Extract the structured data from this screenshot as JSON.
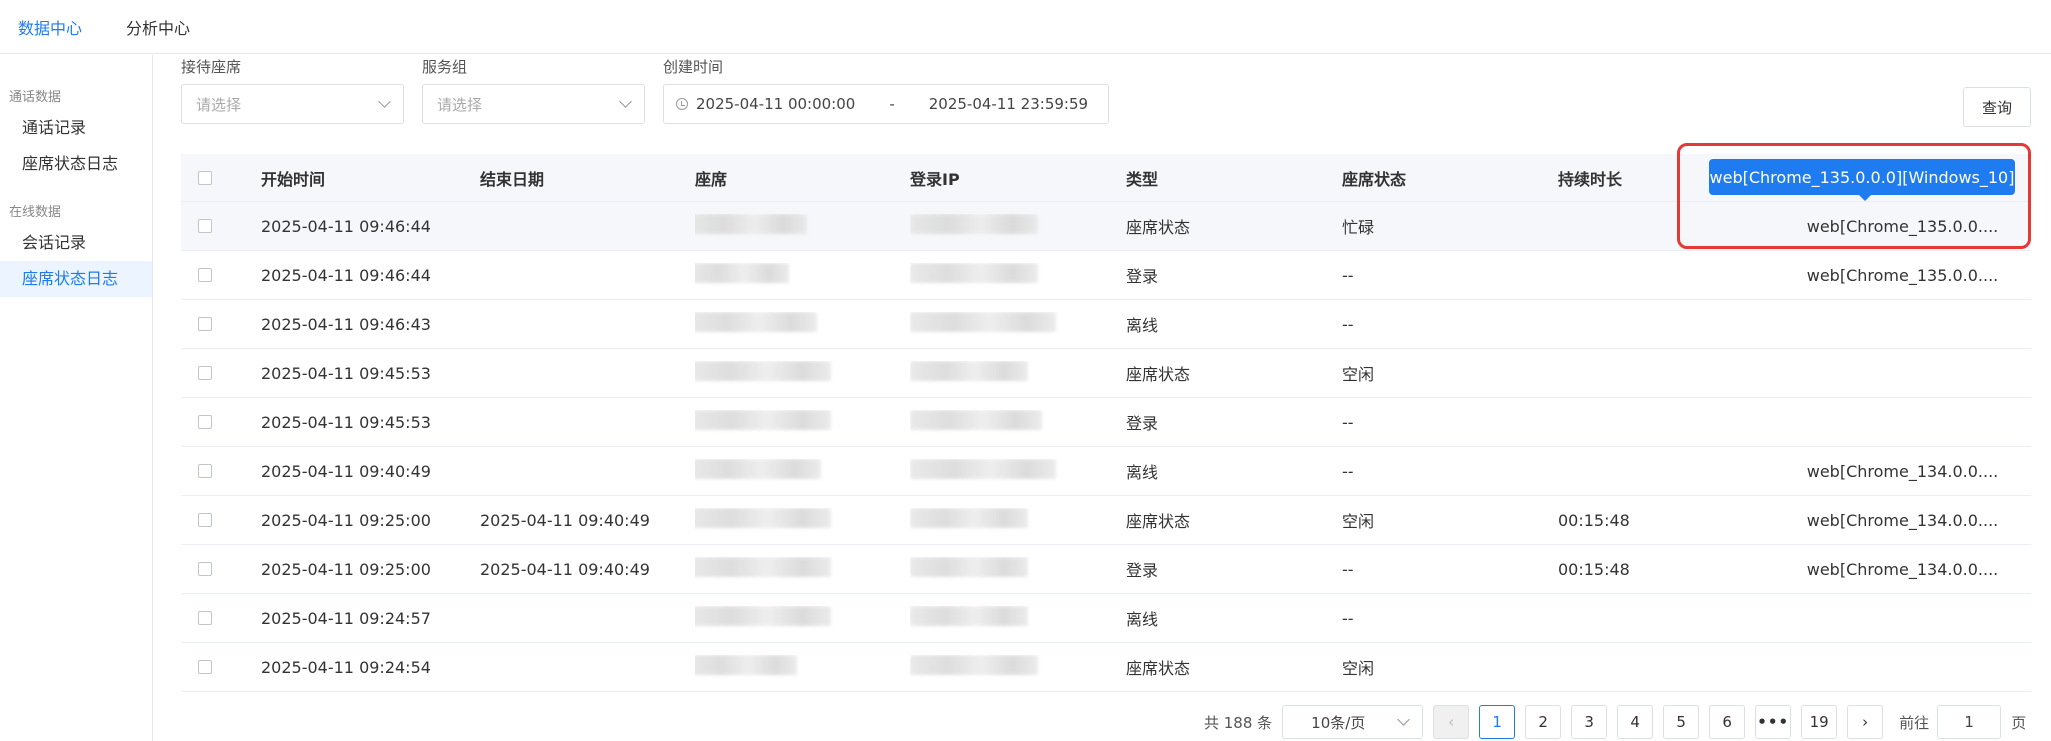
{
  "topnav": {
    "items": [
      {
        "label": "数据中心",
        "active": true
      },
      {
        "label": "分析中心",
        "active": false
      }
    ]
  },
  "sidebar": {
    "group1": "通话数据",
    "call_records": "通话记录",
    "seat_log_1": "座席状态日志",
    "group2": "在线数据",
    "session_records": "会话记录",
    "seat_log_2": "座席状态日志"
  },
  "filters": {
    "agent_label": "接待座席",
    "agent_placeholder": "请选择",
    "group_label": "服务组",
    "group_placeholder": "请选择",
    "created_label": "创建时间",
    "date_start": "2025-04-11 00:00:00",
    "date_sep": "-",
    "date_end": "2025-04-11 23:59:59",
    "query_button": "查询"
  },
  "table": {
    "headers": {
      "start": "开始时间",
      "end": "结束日期",
      "seat": "座席",
      "ip": "登录IP",
      "type": "类型",
      "status": "座席状态",
      "duration": "持续时长"
    },
    "tooltip": "web[Chrome_135.0.0.0][Windows_10]",
    "rows": [
      {
        "start": "2025-04-11 09:46:44",
        "end": "",
        "type": "座席状态",
        "status": "忙碌",
        "duration": "",
        "client": "web[Chrome_135.0.0...."
      },
      {
        "start": "2025-04-11 09:46:44",
        "end": "",
        "type": "登录",
        "status": "--",
        "duration": "",
        "client": "web[Chrome_135.0.0...."
      },
      {
        "start": "2025-04-11 09:46:43",
        "end": "",
        "type": "离线",
        "status": "--",
        "duration": "",
        "client": ""
      },
      {
        "start": "2025-04-11 09:45:53",
        "end": "",
        "type": "座席状态",
        "status": "空闲",
        "duration": "",
        "client": ""
      },
      {
        "start": "2025-04-11 09:45:53",
        "end": "",
        "type": "登录",
        "status": "--",
        "duration": "",
        "client": ""
      },
      {
        "start": "2025-04-11 09:40:49",
        "end": "",
        "type": "离线",
        "status": "--",
        "duration": "",
        "client": "web[Chrome_134.0.0...."
      },
      {
        "start": "2025-04-11 09:25:00",
        "end": "2025-04-11 09:40:49",
        "type": "座席状态",
        "status": "空闲",
        "duration": "00:15:48",
        "client": "web[Chrome_134.0.0...."
      },
      {
        "start": "2025-04-11 09:25:00",
        "end": "2025-04-11 09:40:49",
        "type": "登录",
        "status": "--",
        "duration": "00:15:48",
        "client": "web[Chrome_134.0.0...."
      },
      {
        "start": "2025-04-11 09:24:57",
        "end": "",
        "type": "离线",
        "status": "--",
        "duration": "",
        "client": ""
      },
      {
        "start": "2025-04-11 09:24:54",
        "end": "",
        "type": "座席状态",
        "status": "空闲",
        "duration": "",
        "client": ""
      }
    ]
  },
  "pagination": {
    "total": "共 188 条",
    "page_size": "10条/页",
    "prev": "‹",
    "pages": [
      "1",
      "2",
      "3",
      "4",
      "5",
      "6"
    ],
    "more": "•••",
    "last": "19",
    "next": "›",
    "goto_label": "前往",
    "goto_value": "1",
    "page_unit": "页"
  },
  "colors": {
    "accent": "#1e7cf0",
    "highlight": "#e53935"
  }
}
